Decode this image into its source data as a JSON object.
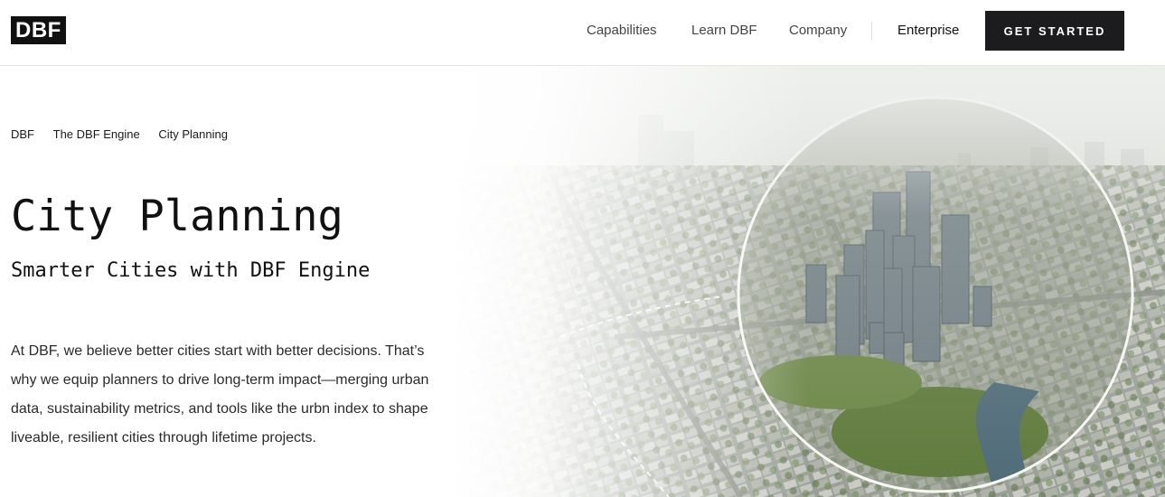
{
  "header": {
    "logo_text": "DBF",
    "nav": {
      "capabilities": "Capabilities",
      "learn": "Learn DBF",
      "company": "Company",
      "enterprise": "Enterprise"
    },
    "cta_label": "GET STARTED"
  },
  "breadcrumb": [
    "DBF",
    "The DBF Engine",
    "City Planning"
  ],
  "hero": {
    "title": "City Planning",
    "subtitle": "Smarter Cities with DBF Engine",
    "body": "At DBF, we believe better cities start with better decisions. That’s why we equip planners to drive long-term impact—merging urban data, sustainability metrics, and tools like the urbn index to shape liveable, resilient cities through lifetime projects."
  },
  "colors": {
    "cta_bg": "#1c1c1e",
    "logo_bg": "#111111",
    "text": "#1a1a1a"
  }
}
